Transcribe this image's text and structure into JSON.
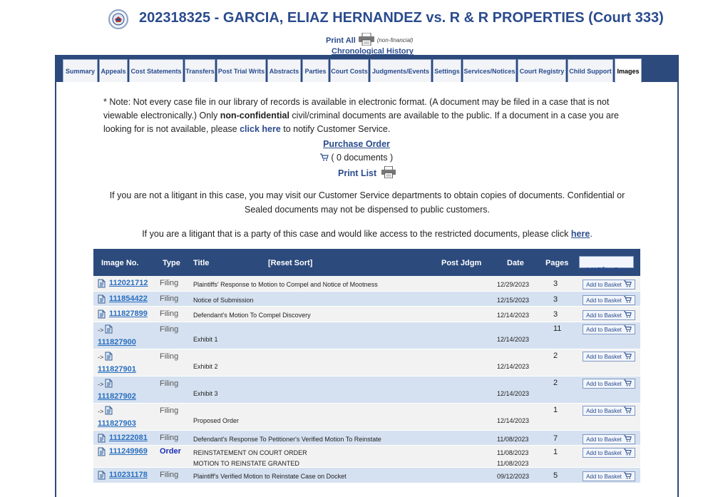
{
  "header": {
    "title": "202318325 - GARCIA, ELIAZ HERNANDEZ vs. R & R PROPERTIES (Court 333)",
    "print_all": "Print All",
    "non_financial": "(non-financial)",
    "chronological": "Chronological History"
  },
  "tabs": [
    {
      "label": "Summary"
    },
    {
      "label": "Appeals"
    },
    {
      "label": "Cost Statements"
    },
    {
      "label": "Transfers"
    },
    {
      "label": "Post Trial Writs"
    },
    {
      "label": "Abstracts"
    },
    {
      "label": "Parties"
    },
    {
      "label": "Court Costs"
    },
    {
      "label": "Judgments/Events"
    },
    {
      "label": "Settings"
    },
    {
      "label": "Services/Notices"
    },
    {
      "label": "Court Registry"
    },
    {
      "label": "Child Support"
    },
    {
      "label": "Images"
    }
  ],
  "note": {
    "part1": "* Note: Not every case file in our library of records is available in electronic format. (A document may be filed in a case that is not viewable electronically.) Only ",
    "bold": "non-confidential",
    "part2": " civil/criminal documents are available to the public. If a document in a case you are looking for is not available, please ",
    "link": "click here",
    "part3": " to notify Customer Service."
  },
  "purchase_order": "Purchase Order",
  "documents_count": "( 0 documents )",
  "print_list": "Print List",
  "para1": "If you are not a litigant in this case, you may visit our Customer Service departments to obtain copies of documents. Confidential or Sealed documents may not be dispensed to public customers.",
  "para2": {
    "text": "If you are a litigant that is a party of this case and would like access to the restricted documents, please click ",
    "link": "here",
    "end": "."
  },
  "table": {
    "headers": {
      "image_no": "Image No.",
      "type": "Type",
      "title": "Title",
      "reset_sort": "[Reset Sort]",
      "post_jdgm": "Post Jdgm",
      "date": "Date",
      "pages": "Pages",
      "add_entire": "Add Entire Case"
    },
    "add_to_basket": "Add to Basket",
    "rows": [
      {
        "image": "112021712",
        "type": "Filing",
        "title": "Plaintiffs' Response to Motion to Compel and Notice of Mootness",
        "date": "12/29/2023",
        "pages": "3"
      },
      {
        "image": "111854422",
        "type": "Filing",
        "title": "Notice of Submission",
        "date": "12/15/2023",
        "pages": "3"
      },
      {
        "image": "111827899",
        "type": "Filing",
        "title": "Defendant's Motion To Compel Discovery",
        "date": "12/14/2023",
        "pages": "3"
      },
      {
        "image": "111827900",
        "type": "Filing",
        "title": "Exhibit 1",
        "date": "12/14/2023",
        "pages": "11",
        "sub": true
      },
      {
        "image": "111827901",
        "type": "Filing",
        "title": "Exhibit 2",
        "date": "12/14/2023",
        "pages": "2",
        "sub": true
      },
      {
        "image": "111827902",
        "type": "Filing",
        "title": "Exhibit 3",
        "date": "12/14/2023",
        "pages": "2",
        "sub": true
      },
      {
        "image": "111827903",
        "type": "Filing",
        "title": "Proposed Order",
        "date": "12/14/2023",
        "pages": "1",
        "sub": true
      },
      {
        "image": "111222081",
        "type": "Filing",
        "title": "Defendant's Response To Petitioner's Verified Motion To Reinstate",
        "date": "11/08/2023",
        "pages": "7"
      },
      {
        "image": "111249969",
        "type": "Order",
        "title": "REINSTATEMENT ON COURT ORDER",
        "title2": "MOTION TO REINSTATE GRANTED",
        "date": "11/08/2023",
        "date2": "11/08/2023",
        "pages": "1"
      },
      {
        "image": "110231178",
        "type": "Filing",
        "title": "Plaintiff's Verified Motion to Reinstate Case on Docket",
        "date": "09/12/2023",
        "pages": "5"
      }
    ]
  }
}
